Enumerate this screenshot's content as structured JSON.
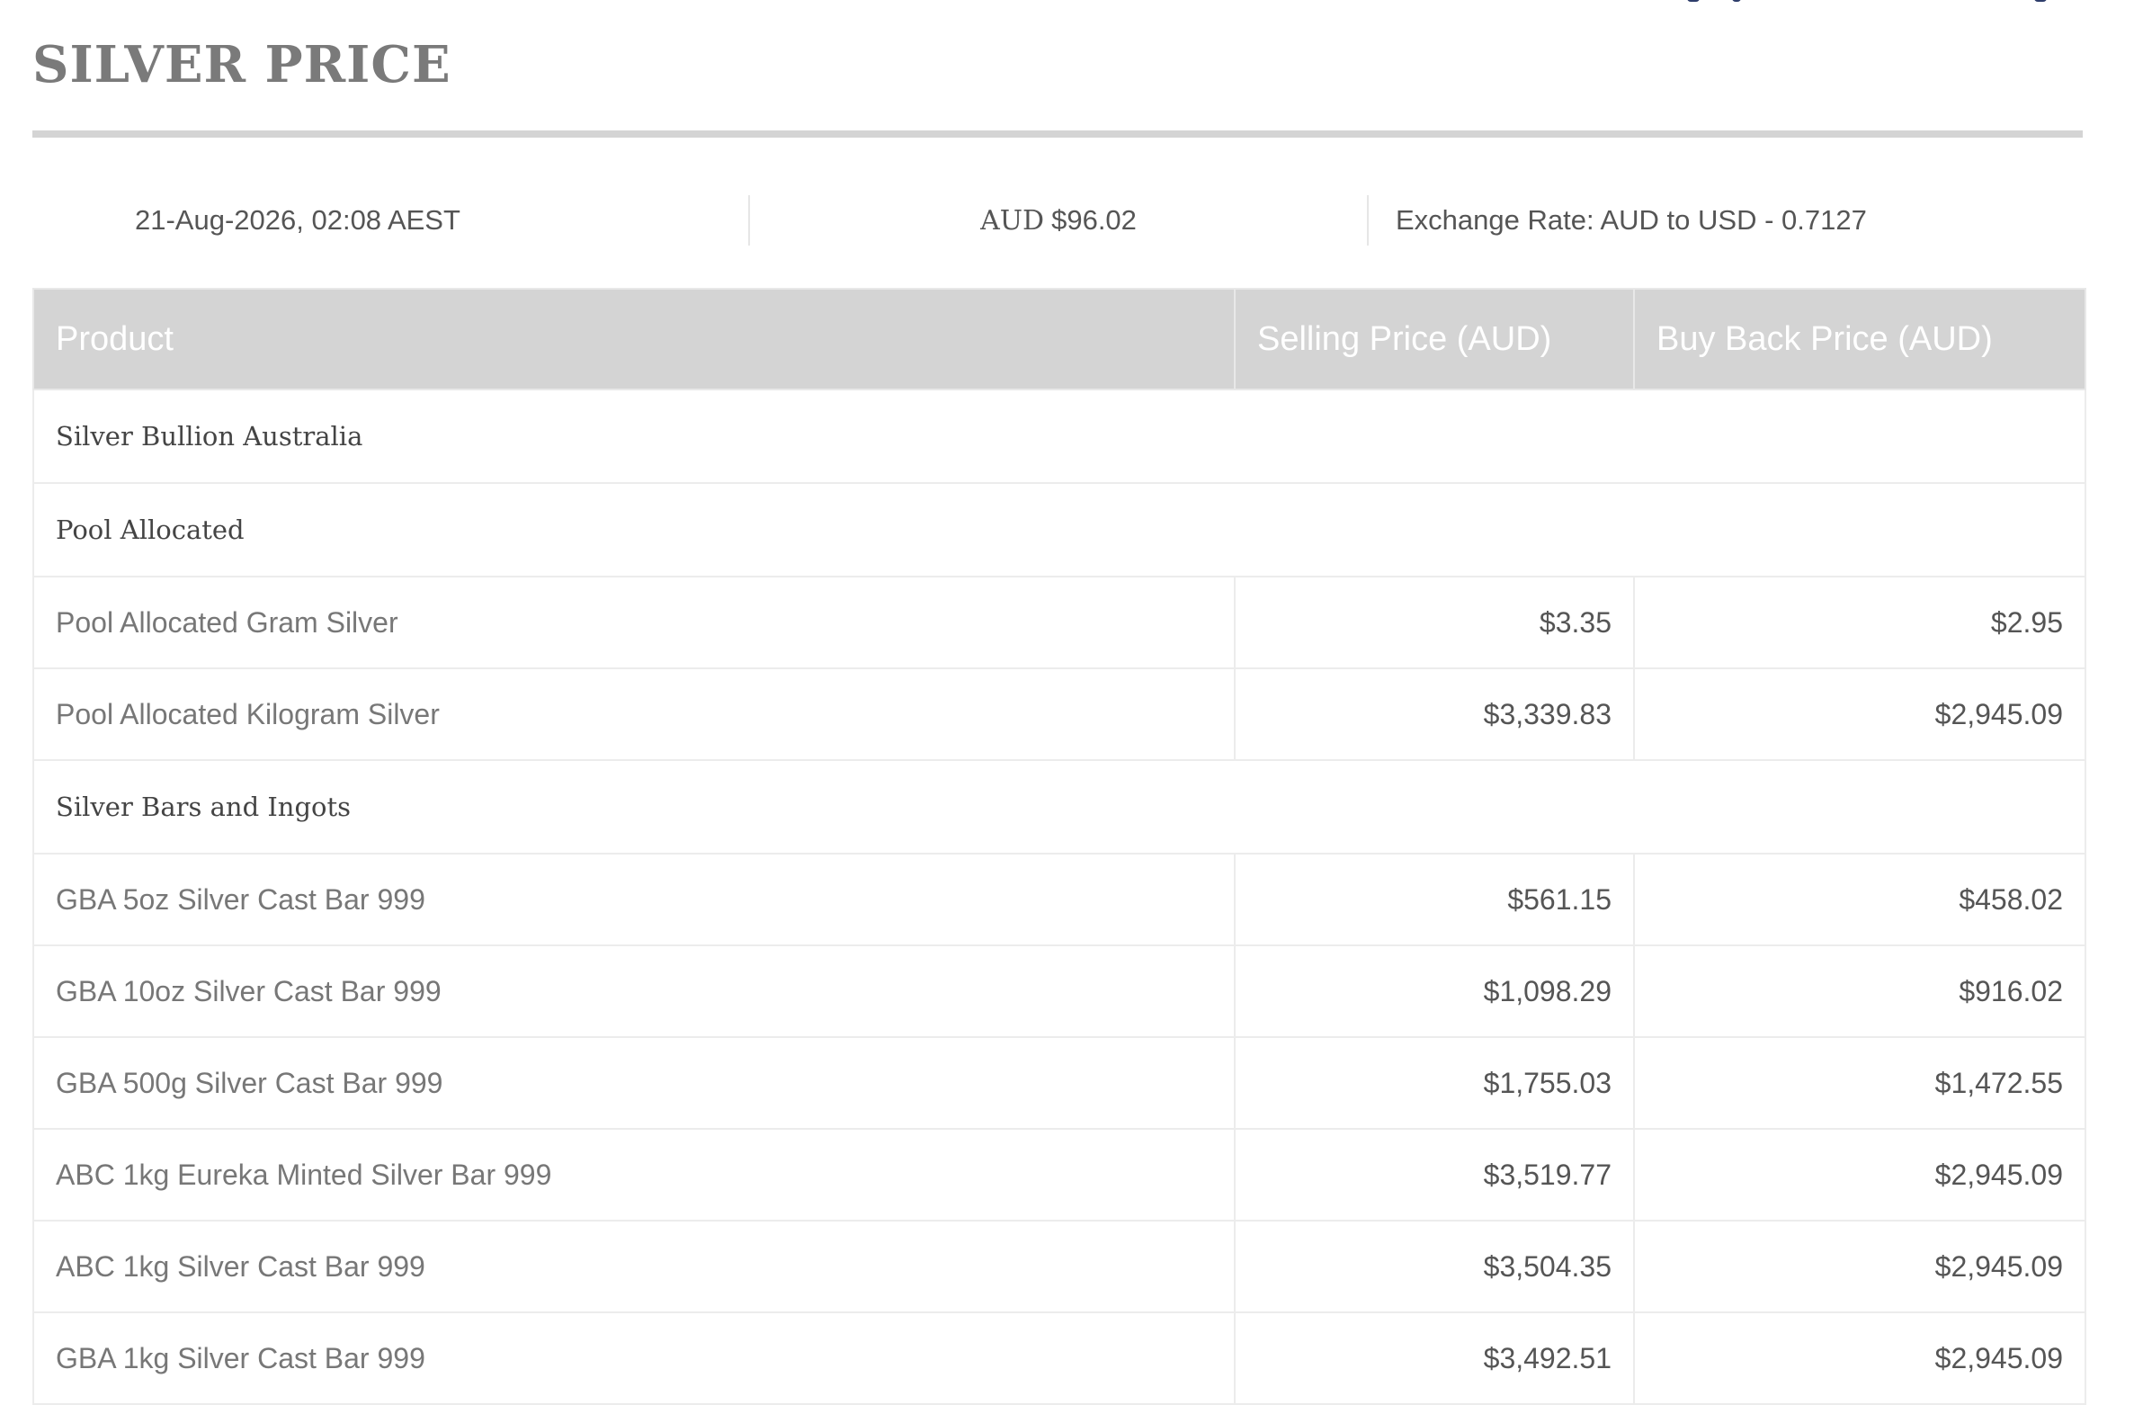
{
  "page": {
    "title": "SILVER PRICE"
  },
  "info": {
    "date": "21-Aug-2026, 02:08 AEST",
    "price_currency": "AUD",
    "price_value": "$96.02",
    "exchange_rate": "Exchange Rate: AUD to USD - 0.7127"
  },
  "table": {
    "headers": [
      "Product",
      "Selling Price (AUD)",
      "Buy Back Price (AUD)"
    ],
    "groups": [
      {
        "label": "Silver Bullion Australia",
        "items": []
      },
      {
        "label": "Pool Allocated",
        "items": [
          {
            "product": "Pool Allocated Gram Silver",
            "selling": "$3.35",
            "buyback": "$2.95"
          },
          {
            "product": "Pool Allocated Kilogram Silver",
            "selling": "$3,339.83",
            "buyback": "$2,945.09"
          }
        ]
      },
      {
        "label": "Silver Bars and Ingots",
        "items": [
          {
            "product": "GBA 5oz Silver Cast Bar 999",
            "selling": "$561.15",
            "buyback": "$458.02"
          },
          {
            "product": "GBA 10oz Silver Cast Bar 999",
            "selling": "$1,098.29",
            "buyback": "$916.02"
          },
          {
            "product": "GBA 500g Silver Cast Bar 999",
            "selling": "$1,755.03",
            "buyback": "$1,472.55"
          },
          {
            "product": "ABC 1kg Eureka Minted Silver Bar 999",
            "selling": "$3,519.77",
            "buyback": "$2,945.09"
          },
          {
            "product": "ABC 1kg Silver Cast Bar 999",
            "selling": "$3,504.35",
            "buyback": "$2,945.09"
          },
          {
            "product": "GBA 1kg Silver Cast Bar 999",
            "selling": "$3,492.51",
            "buyback": "$2,945.09"
          }
        ]
      }
    ]
  },
  "colors": {
    "header_bg": "#d4d4d4",
    "title": "#7a7a7a",
    "border": "#ececec"
  }
}
